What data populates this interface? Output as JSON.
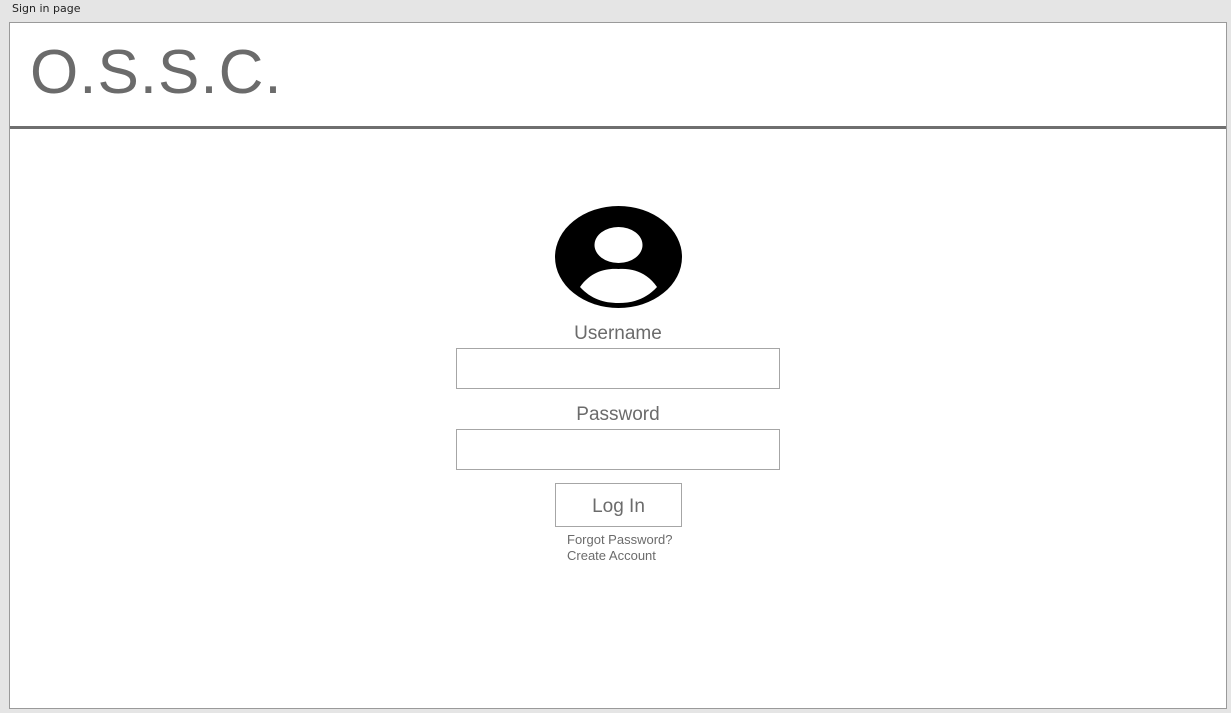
{
  "page": {
    "tab_label": "Sign in page"
  },
  "header": {
    "logo_text": "O.S.S.C."
  },
  "login_form": {
    "username_label": "Username",
    "username_value": "",
    "password_label": "Password",
    "password_value": "",
    "login_button_label": "Log In",
    "forgot_password_label": "Forgot Password?",
    "create_account_label": "Create Account",
    "avatar_icon": "user-circle-icon"
  }
}
